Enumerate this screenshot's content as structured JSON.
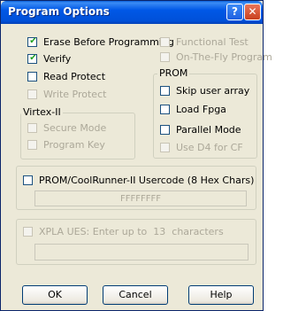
{
  "window": {
    "title": "Program Options"
  },
  "titlebar": {
    "help_glyph": "?",
    "close_glyph": "✕"
  },
  "options_left": [
    {
      "label": "Erase Before Programming",
      "checked": true,
      "enabled": true
    },
    {
      "label": "Verify",
      "checked": true,
      "enabled": true
    },
    {
      "label": "Read Protect",
      "checked": false,
      "enabled": true
    },
    {
      "label": "Write Protect",
      "checked": false,
      "enabled": false
    }
  ],
  "options_right": [
    {
      "label": "Functional Test",
      "checked": false,
      "enabled": false
    },
    {
      "label": "On-The-Fly Program",
      "checked": false,
      "enabled": false
    }
  ],
  "virtex": {
    "title": "Virtex-II",
    "items": [
      {
        "label": "Secure Mode",
        "checked": false,
        "enabled": false
      },
      {
        "label": "Program Key",
        "checked": false,
        "enabled": false
      }
    ]
  },
  "prom": {
    "title": "PROM",
    "items": [
      {
        "label": "Skip user array",
        "checked": false,
        "enabled": true
      },
      {
        "label": "Load Fpga",
        "checked": false,
        "enabled": true
      },
      {
        "label": "Parallel Mode",
        "checked": false,
        "enabled": true
      },
      {
        "label": "Use D4 for CF",
        "checked": false,
        "enabled": false
      }
    ]
  },
  "usercode": {
    "label": "PROM/CoolRunner-II Usercode (8 Hex Chars)",
    "value": "FFFFFFFF",
    "checked": false
  },
  "xpla": {
    "label_prefix": "XPLA UES: Enter up to",
    "max_chars": "13",
    "label_suffix": "characters",
    "value": ""
  },
  "buttons": {
    "ok": "OK",
    "cancel": "Cancel",
    "help": "Help"
  },
  "colors": {
    "title_bar": "#0058e6",
    "dialog_bg": "#ece9d8",
    "check_tick": "#21a121",
    "disabled_text": "#aca899"
  }
}
